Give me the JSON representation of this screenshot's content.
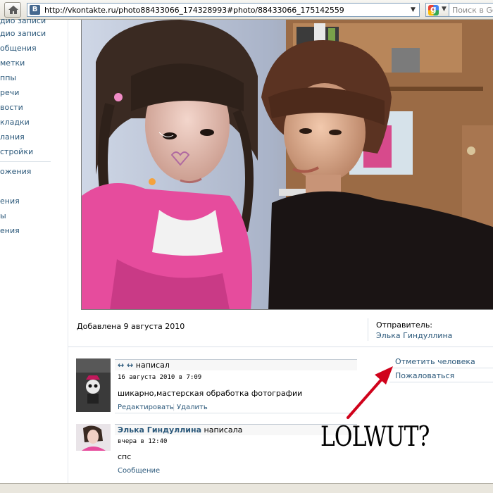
{
  "browser": {
    "url": "http://vkontakte.ru/photo88433066_174328993#photo/88433066_175142559",
    "favicon_text": "B",
    "search_placeholder": "Поиск в Goo"
  },
  "left_nav": {
    "items": [
      {
        "label": "Мои Аудиозаписи",
        "visible_label": "дио записи"
      },
      {
        "label": "сообщения",
        "visible_label": "общения"
      },
      {
        "label": "заметки",
        "visible_label": "метки"
      },
      {
        "label": "группы",
        "visible_label": "ппы"
      },
      {
        "label": "встречи",
        "visible_label": "речи"
      },
      {
        "label": "новости",
        "visible_label": "вости"
      },
      {
        "label": "закладки",
        "visible_label": "кладки"
      },
      {
        "label": "желания",
        "visible_label": "лания"
      },
      {
        "label": "настройки",
        "visible_label": "стройки"
      },
      {
        "label": "приложения",
        "visible_label": "ожения"
      },
      {
        "label": "",
        "visible_label": "ения"
      },
      {
        "label": "",
        "visible_label": "ы"
      },
      {
        "label": "",
        "visible_label": "ения"
      }
    ]
  },
  "photo": {
    "added_text": "Добавлена 9 августа 2010",
    "sender_label": "Отправитель:",
    "sender_name": "Элька Гиндуллина"
  },
  "actions": {
    "tag_person": "Отметить человека",
    "report": "Пожаловаться"
  },
  "comments": [
    {
      "author": "↔ ↔",
      "verb": " написал",
      "date": "16 августа 2010 в 7:09",
      "text": "шикарно,мастерская обработка фотографии",
      "actions": [
        "Редактировать",
        "Удалить"
      ]
    },
    {
      "author": "Элька Гиндуллина",
      "verb": " написала",
      "date": "вчера в 12:40",
      "text": "спс",
      "actions": [
        "Сообщение"
      ]
    }
  ],
  "annotation": {
    "text": "LOLWUT?",
    "arrow_color": "#d0021b"
  }
}
